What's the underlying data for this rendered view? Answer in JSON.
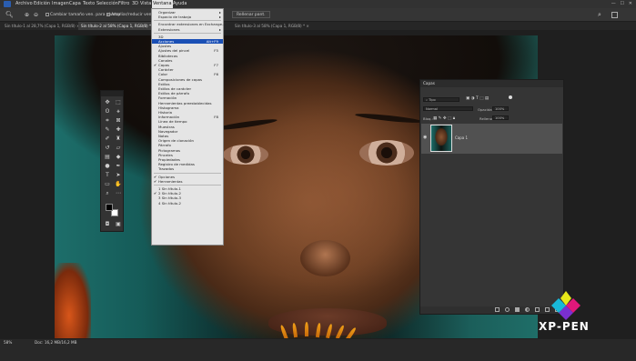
{
  "menubar": {
    "items": [
      "Archivo",
      "Edición",
      "Imagen",
      "Capa",
      "Texto",
      "Selección",
      "Filtro",
      "3D",
      "Vista",
      "Ventana",
      "Ayuda"
    ],
    "active": "Ventana",
    "window_controls": [
      "—",
      "☐",
      "✕"
    ]
  },
  "options": {
    "sample_all": "Cambiar tamaño ven. para ajustar",
    "zoom_all": "Ampliar/reducir ven.",
    "fill_screen": "Rellenar pant."
  },
  "tabs": [
    {
      "label": "Sin título-1 al 28,7% (Capa 1, RGB/8) ×",
      "active": false
    },
    {
      "label": "Sin título-2 al 58% (Capa 1, RGB/8) * ×",
      "active": true
    },
    {
      "label": "Sin título-3 al 58% (Capa 1, RGB/8) * ×",
      "active": false
    }
  ],
  "menu": {
    "items": [
      {
        "label": "Organizar",
        "arrow": true
      },
      {
        "label": "Espacio de trabajo",
        "arrow": true
      },
      {
        "sep": true
      },
      {
        "label": "Encontrar extensiones en Exchange..."
      },
      {
        "label": "Extensiones",
        "arrow": true
      },
      {
        "sep": true
      },
      {
        "label": "3D"
      },
      {
        "label": "Acciones",
        "shortcut": "Alt+F9",
        "highlight": true
      },
      {
        "label": "Ajustes"
      },
      {
        "label": "Ajustes del pincel",
        "shortcut": "F5"
      },
      {
        "label": "Bibliotecas"
      },
      {
        "label": "Canales"
      },
      {
        "label": "Capas",
        "shortcut": "F7",
        "checked": true
      },
      {
        "label": "Carácter"
      },
      {
        "label": "Color",
        "shortcut": "F6"
      },
      {
        "label": "Composiciones de capas"
      },
      {
        "label": "Estilos"
      },
      {
        "label": "Estilos de carácter"
      },
      {
        "label": "Estilos de párrafo"
      },
      {
        "label": "Formación"
      },
      {
        "label": "Herramientas preestablecidas"
      },
      {
        "label": "Histograma"
      },
      {
        "label": "Historia"
      },
      {
        "label": "Información",
        "shortcut": "F8"
      },
      {
        "label": "Línea de tiempo"
      },
      {
        "label": "Muestras"
      },
      {
        "label": "Navegador"
      },
      {
        "label": "Notas"
      },
      {
        "label": "Origen de clonación"
      },
      {
        "label": "Párrafo"
      },
      {
        "label": "Pictogramas"
      },
      {
        "label": "Pinceles"
      },
      {
        "label": "Propiedades"
      },
      {
        "label": "Registro de medidas"
      },
      {
        "label": "Trazados"
      },
      {
        "sep": true
      },
      {
        "label": "Opciones",
        "checked": true
      },
      {
        "label": "Herramientas",
        "checked": true
      },
      {
        "sep": true
      },
      {
        "label": "1 Sin título-1"
      },
      {
        "label": "2 Sin título-2",
        "checked": true
      },
      {
        "label": "3 Sin título-3"
      },
      {
        "label": "4 Sin título-2"
      }
    ]
  },
  "layers_panel": {
    "title": "Capas",
    "kind_filter": "Tipo",
    "blend_mode": "Normal",
    "opacity_label": "Opacidad:",
    "opacity_value": "100%",
    "lock_label": "Bloq.:",
    "fill_label": "Relleno:",
    "fill_value": "100%",
    "layer_name": "Capa 1"
  },
  "status": {
    "zoom": "58%",
    "doc_info": "Doc: 16,2 MB/16,2 MB"
  },
  "brand": {
    "name": "XP-PEN",
    "colors": [
      "#e8e81a",
      "#e0187a",
      "#7a2fd0",
      "#18b8d8"
    ]
  }
}
